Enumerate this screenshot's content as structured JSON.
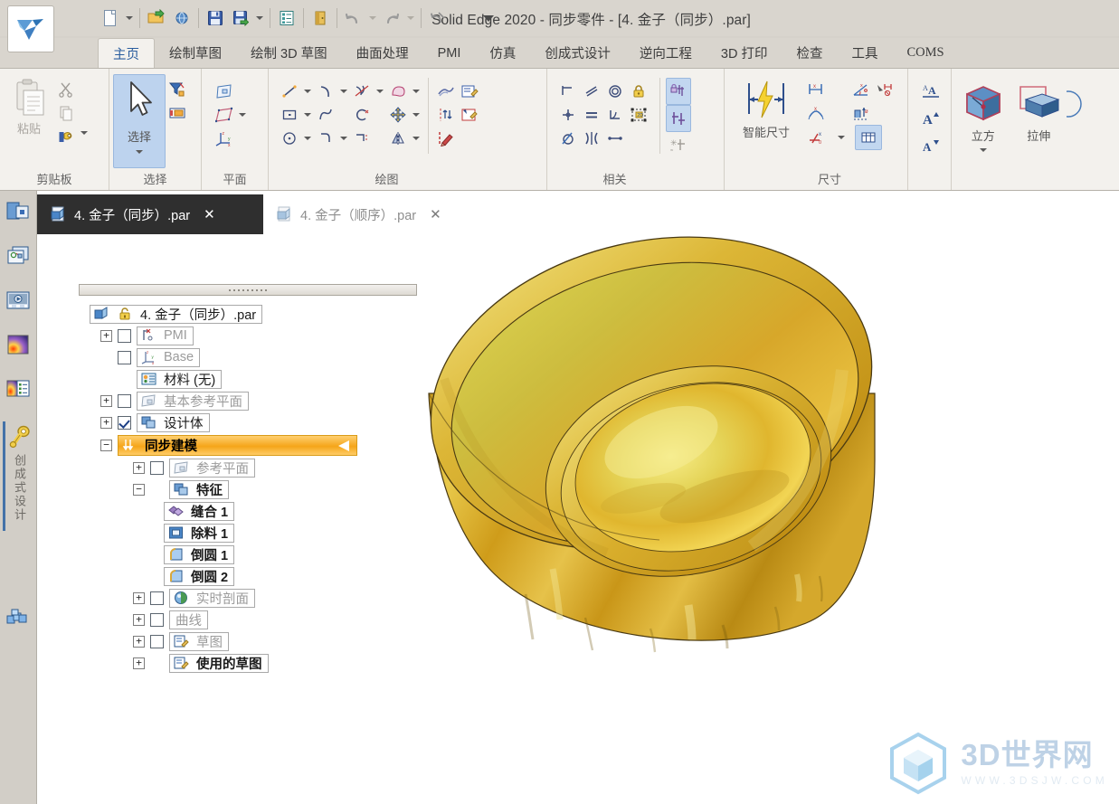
{
  "window": {
    "title": "Solid Edge 2020 - 同步零件 - [4. 金子（同步）.par]",
    "app_logo_name": "solid-edge-logo"
  },
  "quick_access": {
    "items": [
      {
        "name": "new-document",
        "label": "新建"
      },
      {
        "name": "new-dropdown",
        "label": "新建下拉"
      },
      {
        "name": "open-document",
        "label": "打开"
      },
      {
        "name": "open-web",
        "label": "打开网页"
      },
      {
        "name": "save",
        "label": "保存"
      },
      {
        "name": "save-as",
        "label": "另存为"
      },
      {
        "name": "save-dropdown",
        "label": "保存下拉"
      },
      {
        "name": "properties",
        "label": "属性"
      },
      {
        "name": "close-doc",
        "label": "关闭"
      },
      {
        "name": "undo",
        "label": "撤消"
      },
      {
        "name": "undo-dropdown",
        "label": "撤消下拉"
      },
      {
        "name": "redo",
        "label": "恢复"
      },
      {
        "name": "redo-dropdown",
        "label": "恢复下拉"
      },
      {
        "name": "repeat",
        "label": "重复"
      },
      {
        "name": "customize-qat",
        "label": "自定义快速访问工具栏"
      }
    ]
  },
  "ribbon": {
    "tabs": [
      {
        "label": "主页",
        "active": true
      },
      {
        "label": "绘制草图",
        "active": false
      },
      {
        "label": "绘制 3D 草图",
        "active": false
      },
      {
        "label": "曲面处理",
        "active": false
      },
      {
        "label": "PMI",
        "active": false
      },
      {
        "label": "仿真",
        "active": false
      },
      {
        "label": "创成式设计",
        "active": false
      },
      {
        "label": "逆向工程",
        "active": false
      },
      {
        "label": "3D 打印",
        "active": false
      },
      {
        "label": "检查",
        "active": false
      },
      {
        "label": "工具",
        "active": false
      },
      {
        "label": "COMS",
        "active": false
      }
    ],
    "groups": [
      {
        "name": "clipboard",
        "label": "剪贴板",
        "big": {
          "label": "粘贴",
          "icon": "paste-icon",
          "disabled": true
        },
        "small": [
          {
            "name": "cut-icon",
            "label": "剪切"
          },
          {
            "name": "copy-icon",
            "label": "复制"
          },
          {
            "name": "paint-format-icon",
            "label": "格式刷"
          }
        ]
      },
      {
        "name": "select",
        "label": "选择",
        "big": {
          "label": "选择",
          "icon": "arrow-cursor-icon",
          "selected": true
        },
        "small": [
          {
            "name": "select-filter-icon",
            "label": "选择过滤器"
          },
          {
            "name": "select-tool-icon",
            "label": "选择工具"
          }
        ]
      },
      {
        "name": "plane",
        "label": "平面",
        "small": [
          {
            "name": "coincident-plane-icon",
            "label": "重合平面"
          },
          {
            "name": "parallel-plane-icon",
            "label": "平行平面"
          },
          {
            "name": "coordinate-system-icon",
            "label": "坐标系"
          }
        ]
      },
      {
        "name": "draw",
        "label": "绘图",
        "small": [
          {
            "name": "line-icon",
            "label": "直线"
          },
          {
            "name": "arc-icon",
            "label": "圆弧"
          },
          {
            "name": "fillet-icon",
            "label": "圆角"
          },
          {
            "name": "region-icon",
            "label": "区域"
          },
          {
            "name": "rectangle-icon",
            "label": "矩形"
          },
          {
            "name": "curve-icon",
            "label": "曲线"
          },
          {
            "name": "trim-icon",
            "label": "修剪"
          },
          {
            "name": "move-icon",
            "label": "移动"
          },
          {
            "name": "circle-icon",
            "label": "圆"
          },
          {
            "name": "tangent-arc-icon",
            "label": "相切弧"
          },
          {
            "name": "offset-icon",
            "label": "偏置"
          },
          {
            "name": "mirror-icon",
            "label": "镜像"
          },
          {
            "name": "project-curve-icon",
            "label": "投影曲线"
          },
          {
            "name": "edit-sketch-icon",
            "label": "编辑草图"
          },
          {
            "name": "sketch-relation-icon",
            "label": "草图关系"
          },
          {
            "name": "sketch-region-icon",
            "label": "草图区域"
          },
          {
            "name": "draw-pencil-icon",
            "label": "绘制"
          }
        ]
      },
      {
        "name": "relate",
        "label": "相关",
        "small": [
          {
            "name": "perpendicular-icon",
            "label": "垂直"
          },
          {
            "name": "parallel-icon",
            "label": "平行"
          },
          {
            "name": "concentric-icon",
            "label": "同心"
          },
          {
            "name": "lock-icon",
            "label": "锁定"
          },
          {
            "name": "connect-icon",
            "label": "连接"
          },
          {
            "name": "equal-icon",
            "label": "相等"
          },
          {
            "name": "tangent-icon",
            "label": "相切"
          },
          {
            "name": "rigid-set-icon",
            "label": "刚性集"
          },
          {
            "name": "symmetric-icon",
            "label": "对称"
          },
          {
            "name": "mirror-relation-icon",
            "label": "镜像关系"
          },
          {
            "name": "horizontal-icon",
            "label": "水平/竖直"
          },
          {
            "name": "relationship-handles-icon",
            "label": "关系手柄"
          },
          {
            "name": "maintain-relations-icon",
            "label": "保持关系"
          },
          {
            "name": "persist-relations-icon",
            "label": "保持相关"
          }
        ]
      },
      {
        "name": "dimension",
        "label": "尺寸",
        "big": {
          "label": "智能尺寸",
          "icon": "smart-dimension-icon"
        },
        "small": [
          {
            "name": "distance-between-icon",
            "label": "间距"
          },
          {
            "name": "angle-between-icon",
            "label": "夹角"
          },
          {
            "name": "coordinate-dimension-icon",
            "label": "坐标尺寸"
          },
          {
            "name": "arc-length-icon",
            "label": "弧长"
          },
          {
            "name": "symmetric-diameter-icon",
            "label": "对称直径"
          },
          {
            "name": "dimension-axis-icon",
            "label": "尺寸轴"
          },
          {
            "name": "dimension-dropdown",
            "label": "尺寸下拉"
          },
          {
            "name": "dimension-table-icon",
            "label": "尺寸表"
          }
        ]
      },
      {
        "name": "text-format",
        "label": "",
        "small": [
          {
            "name": "font-style-icon",
            "label": "字体样式"
          },
          {
            "name": "increase-font-icon",
            "label": "增大字体"
          },
          {
            "name": "decrease-font-icon",
            "label": "减小字体"
          }
        ]
      },
      {
        "name": "solids",
        "label": "",
        "buttons": [
          {
            "name": "cube-button",
            "label": "立方",
            "icon": "cube-icon",
            "has_dropdown": true
          },
          {
            "name": "extrude-button",
            "label": "拉伸",
            "icon": "extrude-icon",
            "has_dropdown": false
          }
        ]
      }
    ]
  },
  "dockbar": {
    "items": [
      {
        "name": "pathfinder-panel",
        "label": "路径查找器",
        "icon": "pathfinder-icon"
      },
      {
        "name": "layers-panel",
        "label": "图层",
        "icon": "layers-icon"
      },
      {
        "name": "animation-panel",
        "label": "动画",
        "icon": "animation-icon"
      },
      {
        "name": "render-panel",
        "label": "渲染",
        "icon": "render-icon"
      },
      {
        "name": "sensors-panel",
        "label": "传感器",
        "icon": "sensors-icon"
      }
    ],
    "active_panel": {
      "name": "generative-design-panel",
      "label": "创成式设计",
      "icon": "key-icon"
    },
    "bottom_item": {
      "name": "parts-library-panel",
      "label": "零件库",
      "icon": "blocks-icon"
    }
  },
  "doc_tabs": [
    {
      "label": "4. 金子（同步）.par",
      "active": true,
      "close_label": "✕"
    },
    {
      "label": "4. 金子（顺序）.par",
      "active": false,
      "close_label": "✕"
    }
  ],
  "tree": {
    "root": {
      "label": "4. 金子（同步）.par",
      "icon": "part-doc-icon",
      "lock_icon": "lock-icon"
    },
    "nodes": [
      {
        "label": "PMI",
        "indent": 1,
        "expander": "+",
        "checkbox": "unchecked",
        "icon": "pmi-icon",
        "dim": true
      },
      {
        "label": "Base",
        "indent": 1,
        "expander": "",
        "checkbox": "unchecked",
        "icon": "base-csys-icon",
        "dim": true
      },
      {
        "label": "材料 (无)",
        "indent": 1,
        "expander": "",
        "checkbox": "none",
        "icon": "material-icon",
        "dim": false
      },
      {
        "label": "基本参考平面",
        "indent": 1,
        "expander": "+",
        "checkbox": "unchecked",
        "icon": "plane-icon",
        "dim": true
      },
      {
        "label": "设计体",
        "indent": 1,
        "expander": "+",
        "checkbox": "checked",
        "icon": "design-body-icon",
        "dim": false
      },
      {
        "label": "同步建模",
        "indent": 1,
        "expander": "−",
        "checkbox": "none",
        "icon": "sync-modeling-icon",
        "dim": false,
        "highlight": true
      },
      {
        "label": "参考平面",
        "indent": 2,
        "expander": "+",
        "checkbox": "unchecked",
        "icon": "plane-icon",
        "dim": true
      },
      {
        "label": "特征",
        "indent": 2,
        "expander": "−",
        "checkbox": "none",
        "icon": "feature-icon",
        "dim": false,
        "bold": true
      },
      {
        "label": "缝合 1",
        "indent": 3,
        "expander": "",
        "checkbox": "none",
        "icon": "stitch-icon",
        "dim": false,
        "bold": true
      },
      {
        "label": "除料 1",
        "indent": 3,
        "expander": "",
        "checkbox": "none",
        "icon": "cutout-icon",
        "dim": false,
        "bold": true
      },
      {
        "label": "倒圆 1",
        "indent": 3,
        "expander": "",
        "checkbox": "none",
        "icon": "round-icon",
        "dim": false,
        "bold": true
      },
      {
        "label": "倒圆 2",
        "indent": 3,
        "expander": "",
        "checkbox": "none",
        "icon": "round-icon",
        "dim": false,
        "bold": true
      },
      {
        "label": "实时剖面",
        "indent": 2,
        "expander": "+",
        "checkbox": "unchecked",
        "icon": "live-section-icon",
        "dim": true
      },
      {
        "label": "曲线",
        "indent": 2,
        "expander": "+",
        "checkbox": "unchecked",
        "icon": "none",
        "dim": true
      },
      {
        "label": "草图",
        "indent": 2,
        "expander": "+",
        "checkbox": "unchecked",
        "icon": "sketch-icon",
        "dim": true
      },
      {
        "label": "使用的草图",
        "indent": 2,
        "expander": "+",
        "checkbox": "none",
        "icon": "sketch-icon",
        "dim": false,
        "bold": true
      }
    ]
  },
  "viewport": {
    "model_name": "gold-ingot-model",
    "colors": {
      "gold_light": "#f2e06a",
      "gold_mid": "#d9ad2e",
      "gold_dark": "#b8860b",
      "edge": "#4a3a12"
    },
    "watermark": {
      "main": "3D世界网",
      "sub": "WWW.3DSJW.COM",
      "logo_name": "cube-hex-logo"
    }
  }
}
